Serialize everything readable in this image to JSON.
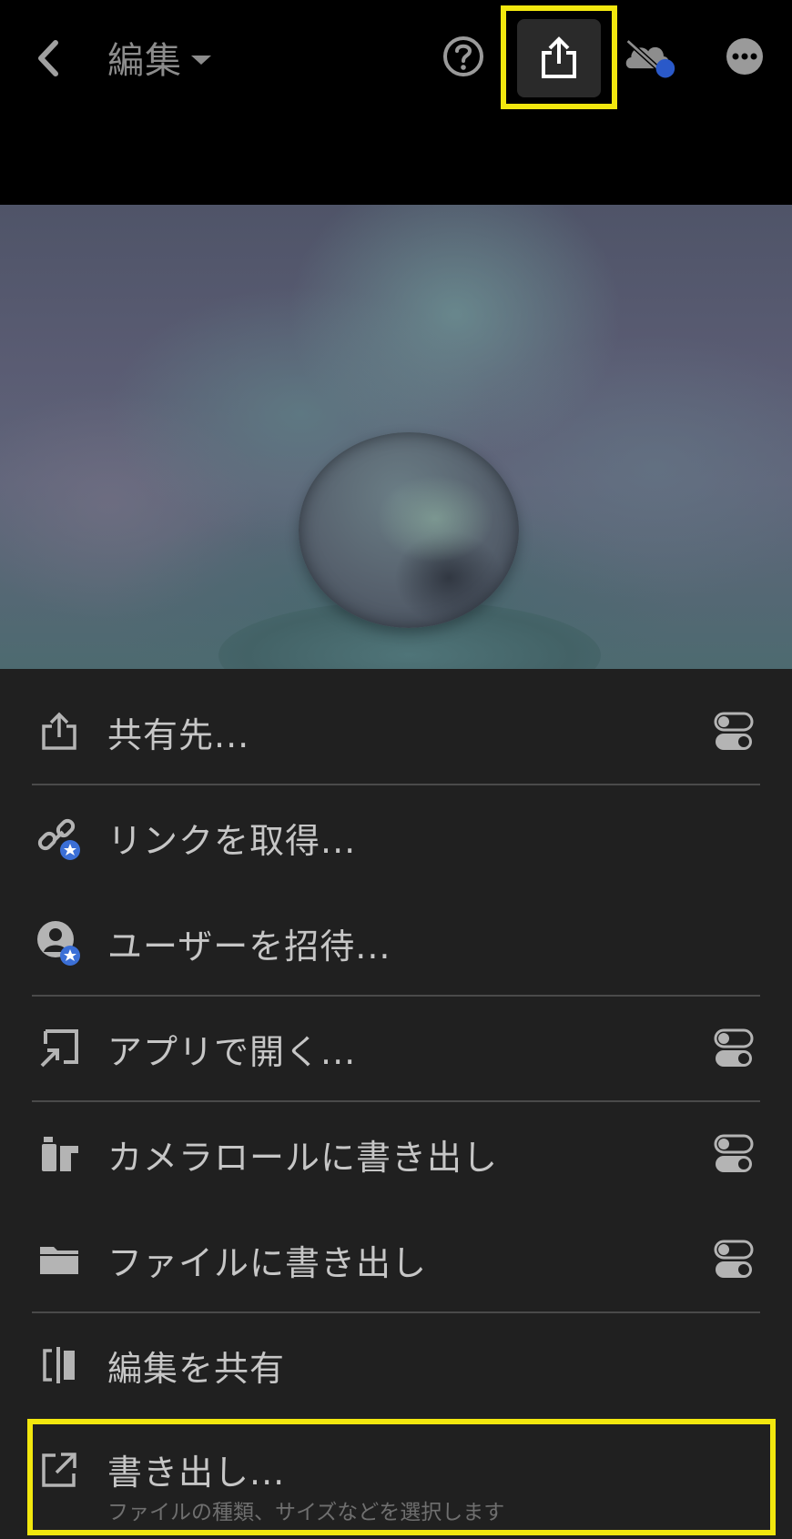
{
  "header": {
    "title": "編集",
    "back_icon": "chevron-left-icon",
    "help_icon": "help-circle-icon",
    "share_icon": "share-upload-icon",
    "cloud_icon": "cloud-off-icon",
    "more_icon": "more-horizontal-icon",
    "highlight_color": "#f2e70e"
  },
  "menu": {
    "items": [
      {
        "label": "共有先...",
        "icon": "share-icon",
        "has_toggle": true
      },
      {
        "label": "リンクを取得...",
        "icon": "link-star-icon",
        "has_toggle": false
      },
      {
        "label": "ユーザーを招待...",
        "icon": "user-star-icon",
        "has_toggle": false
      },
      {
        "label": "アプリで開く...",
        "icon": "open-in-app-icon",
        "has_toggle": true
      },
      {
        "label": "カメラロールに書き出し",
        "icon": "camera-roll-icon",
        "has_toggle": true
      },
      {
        "label": "ファイルに書き出し",
        "icon": "folder-icon",
        "has_toggle": true
      },
      {
        "label": "編集を共有",
        "icon": "compare-icon",
        "has_toggle": false
      }
    ],
    "export": {
      "label": "書き出し...",
      "sublabel": "ファイルの種類、サイズなどを選択します",
      "icon": "export-arrow-icon"
    },
    "toggle_icon": "settings-toggle-icon"
  }
}
